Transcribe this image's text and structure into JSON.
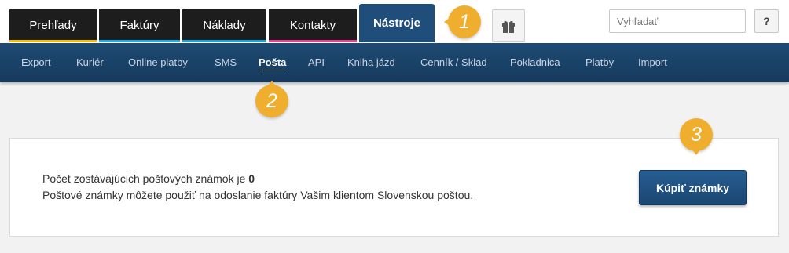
{
  "header": {
    "tabs": [
      {
        "label": "Prehľady",
        "accent": "#f2c200"
      },
      {
        "label": "Faktúry",
        "accent": "#26a9e0"
      },
      {
        "label": "Náklady",
        "accent": "#1aa6d4"
      },
      {
        "label": "Kontakty",
        "accent": "#e0459a"
      },
      {
        "label": "Nástroje",
        "accent": "#1f4e7a",
        "active": true
      }
    ],
    "gift_icon": "gift-icon",
    "search": {
      "placeholder": "Vyhľadať",
      "icon": "search-icon"
    },
    "help_label": "?"
  },
  "subnav": {
    "items": [
      {
        "label": "Export"
      },
      {
        "label": "Kuriér"
      },
      {
        "label": "Online platby"
      },
      {
        "label": "SMS"
      },
      {
        "label": "Pošta",
        "active": true
      },
      {
        "label": "API"
      },
      {
        "label": "Kniha jázd"
      },
      {
        "label": "Cenník / Sklad"
      },
      {
        "label": "Pokladnica"
      },
      {
        "label": "Platby"
      },
      {
        "label": "Import"
      }
    ]
  },
  "main": {
    "stamps_text": "Počet zostávajúcich poštových známok je",
    "stamps_count": "0",
    "info_text": "Poštové známky môžete použiť na odoslanie faktúry Vašim klientom Slovenskou poštou.",
    "buy_button": "Kúpiť známky"
  },
  "callouts": [
    "1",
    "2",
    "3"
  ],
  "colors": {
    "badge": "#f0ae2e",
    "nav": "#1e4a73"
  }
}
